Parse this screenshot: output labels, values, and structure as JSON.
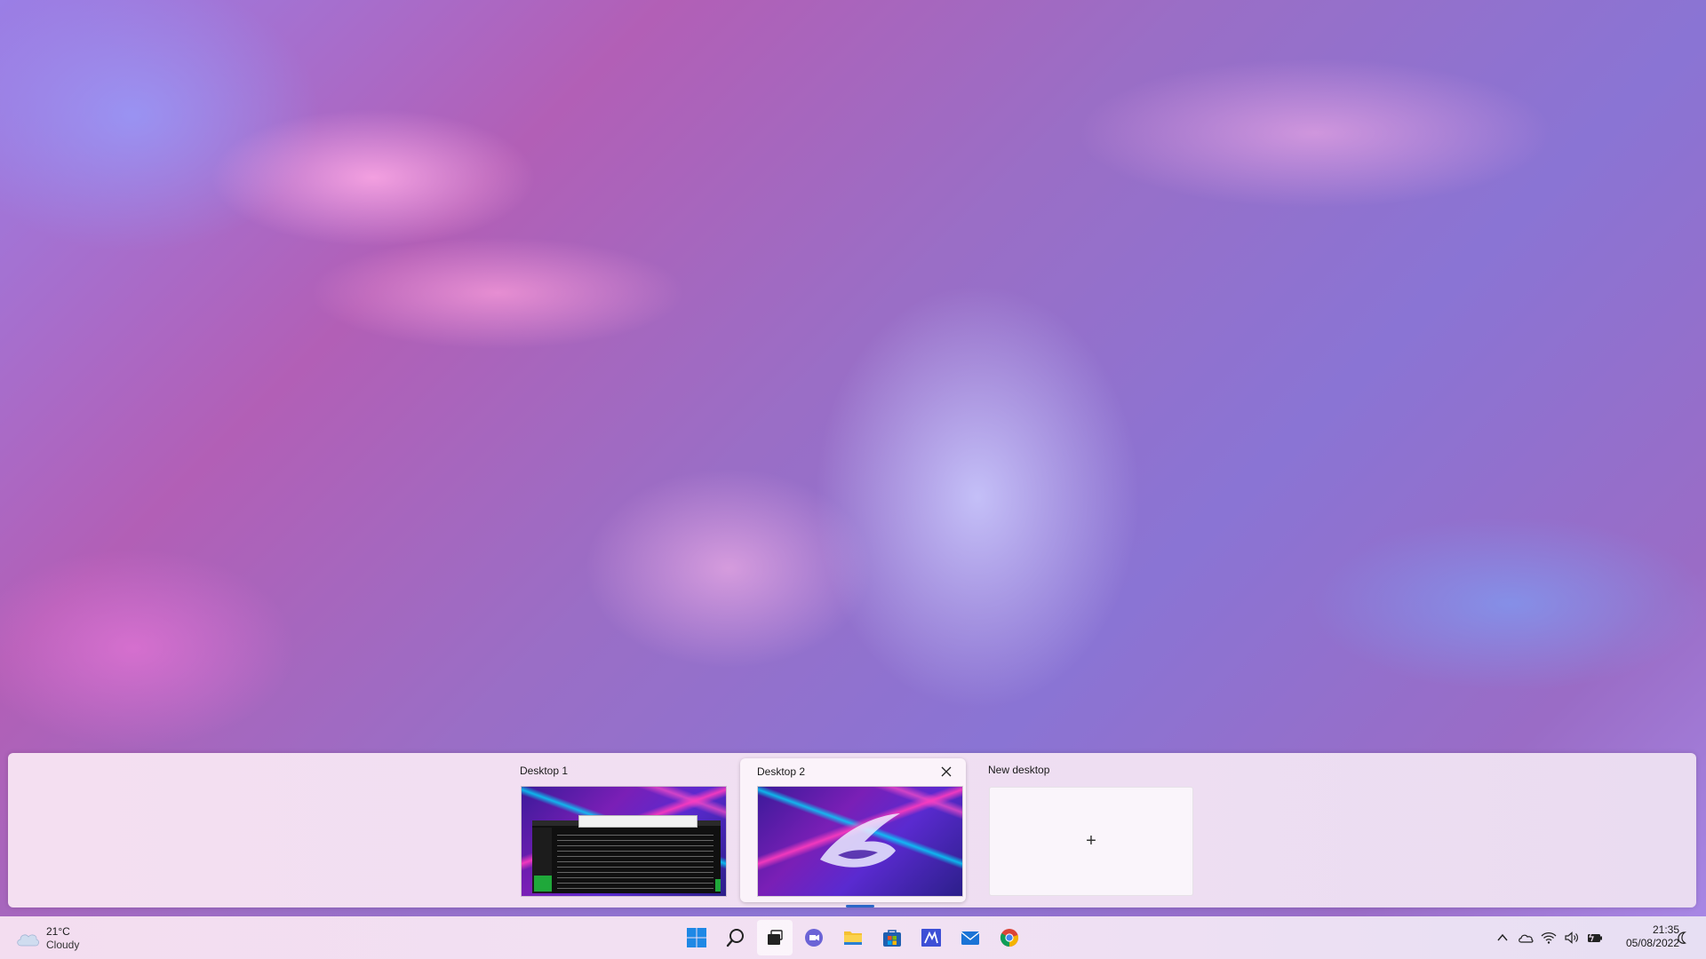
{
  "task_view": {
    "desktops": [
      {
        "label": "Desktop 1"
      },
      {
        "label": "Desktop 2"
      }
    ],
    "new_desktop": {
      "label": "New desktop",
      "plus": "+"
    }
  },
  "taskbar": {
    "weather": {
      "temp": "21°C",
      "condition": "Cloudy"
    },
    "apps": [
      "windows-start-icon",
      "search-icon",
      "task-view-icon",
      "teams-chat-icon",
      "file-explorer-icon",
      "microsoft-store-icon",
      "wacom-icon",
      "mail-icon",
      "chrome-icon"
    ],
    "clock": {
      "time": "21:35",
      "date": "05/08/2022"
    }
  },
  "colors": {
    "accent": "#2b67c7",
    "start": "#1e88e5",
    "folder": "#f5c133"
  }
}
